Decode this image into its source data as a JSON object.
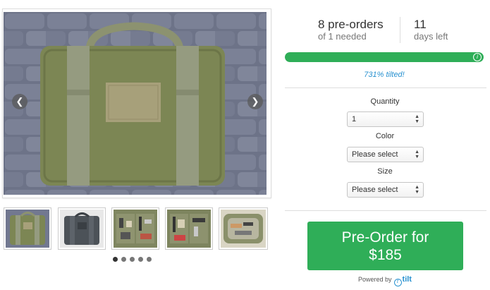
{
  "campaign": {
    "preorder_count": "8 pre-orders",
    "needed": "of 1 needed",
    "days": "11",
    "days_label": "days left",
    "progress_fraction": 1.0,
    "tilt_percent": "731% tilted!"
  },
  "options": {
    "quantity_label": "Quantity",
    "quantity_value": "1",
    "color_label": "Color",
    "color_value": "Please select",
    "size_label": "Size",
    "size_value": "Please select"
  },
  "cta": {
    "line1": "Pre-Order for",
    "line2": "$185"
  },
  "footer": {
    "powered_by": "Powered by",
    "brand": "tilt"
  },
  "gallery": {
    "prev_icon": "chevron-left-icon",
    "next_icon": "chevron-right-icon",
    "thumbnail_count": 5,
    "active_dot": 0
  },
  "colors": {
    "accent_green": "#2fae58",
    "link_blue": "#2a92d0",
    "bag_olive": "#7c8654"
  }
}
